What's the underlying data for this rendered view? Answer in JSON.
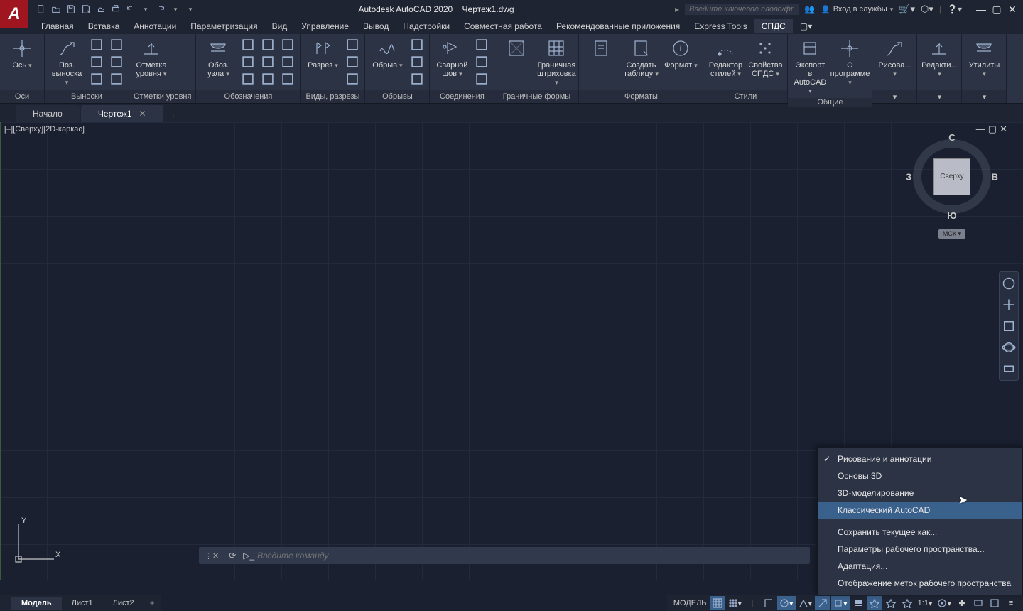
{
  "title": {
    "app": "Autodesk AutoCAD 2020",
    "doc": "Чертеж1.dwg"
  },
  "search": {
    "placeholder": "Введите ключевое слово/фразу"
  },
  "signin": {
    "label": "Вход в службы"
  },
  "menu": [
    "Главная",
    "Вставка",
    "Аннотации",
    "Параметризация",
    "Вид",
    "Управление",
    "Вывод",
    "Надстройки",
    "Совместная работа",
    "Рекомендованные приложения",
    "Express Tools",
    "СПДС"
  ],
  "menu_active": 11,
  "ribbon_panels": [
    {
      "title": "Оси",
      "big": [
        {
          "label": "Ось"
        }
      ]
    },
    {
      "title": "Выноски",
      "big": [
        {
          "label": "Поз.\nвыноска"
        }
      ],
      "cols": 2
    },
    {
      "title": "Отметки уровня",
      "big": [
        {
          "label": "Отметка\nуровня"
        }
      ]
    },
    {
      "title": "Обозначения",
      "big": [
        {
          "label": "Обоз.\nузла"
        }
      ],
      "cols": 3
    },
    {
      "title": "Виды, разрезы",
      "big": [
        {
          "label": "Разрез"
        }
      ],
      "cols": 1
    },
    {
      "title": "Обрывы",
      "big": [
        {
          "label": "Обрыв"
        }
      ],
      "cols": 1
    },
    {
      "title": "Соединения",
      "big": [
        {
          "label": "Сварной шов"
        }
      ],
      "cols": 1
    },
    {
      "title": "Граничные формы",
      "big": [
        {
          "label": ""
        },
        {
          "label": "Граничная\nштриховка"
        }
      ]
    },
    {
      "title": "Форматы",
      "big": [
        {
          "label": ""
        },
        {
          "label": "Создать\nтаблицу"
        },
        {
          "label": "Формат"
        }
      ]
    },
    {
      "title": "Стили",
      "big": [
        {
          "label": "Редактор\nстилей"
        },
        {
          "label": "Свойства\nСПДС"
        }
      ]
    },
    {
      "title": "Общие",
      "big": [
        {
          "label": "Экспорт\nв AutoCAD"
        },
        {
          "label": "О программе"
        }
      ]
    },
    {
      "title": "",
      "big": [
        {
          "label": "Рисова..."
        }
      ],
      "footer": true
    },
    {
      "title": "",
      "big": [
        {
          "label": "Редакти..."
        }
      ],
      "footer": true
    },
    {
      "title": "",
      "big": [
        {
          "label": "Утилиты"
        }
      ],
      "footer": true
    }
  ],
  "doc_tabs": [
    {
      "label": "Начало",
      "active": false
    },
    {
      "label": "Чертеж1",
      "active": true
    }
  ],
  "view_label": "[–][Сверху][2D-каркас]",
  "viewcube": {
    "face": "Сверху",
    "n": "С",
    "s": "Ю",
    "e": "В",
    "w": "З",
    "wcs": "МСК"
  },
  "command": {
    "placeholder": "Введите команду"
  },
  "bottom_tabs": [
    {
      "label": "Модель",
      "active": true
    },
    {
      "label": "Лист1",
      "active": false
    },
    {
      "label": "Лист2",
      "active": false
    }
  ],
  "status": {
    "model": "МОДЕЛЬ",
    "scale": "1:1"
  },
  "ucs": {
    "x": "X",
    "y": "Y"
  },
  "ws_menu": {
    "items": [
      {
        "label": "Рисование и аннотации",
        "checked": true
      },
      {
        "label": "Основы 3D"
      },
      {
        "label": "3D-моделирование"
      },
      {
        "label": "Классический AutoCAD",
        "hl": true
      }
    ],
    "items2": [
      {
        "label": "Сохранить текущее как..."
      },
      {
        "label": "Параметры рабочего пространства..."
      },
      {
        "label": "Адаптация..."
      },
      {
        "label": "Отображение меток рабочего пространства"
      }
    ]
  }
}
